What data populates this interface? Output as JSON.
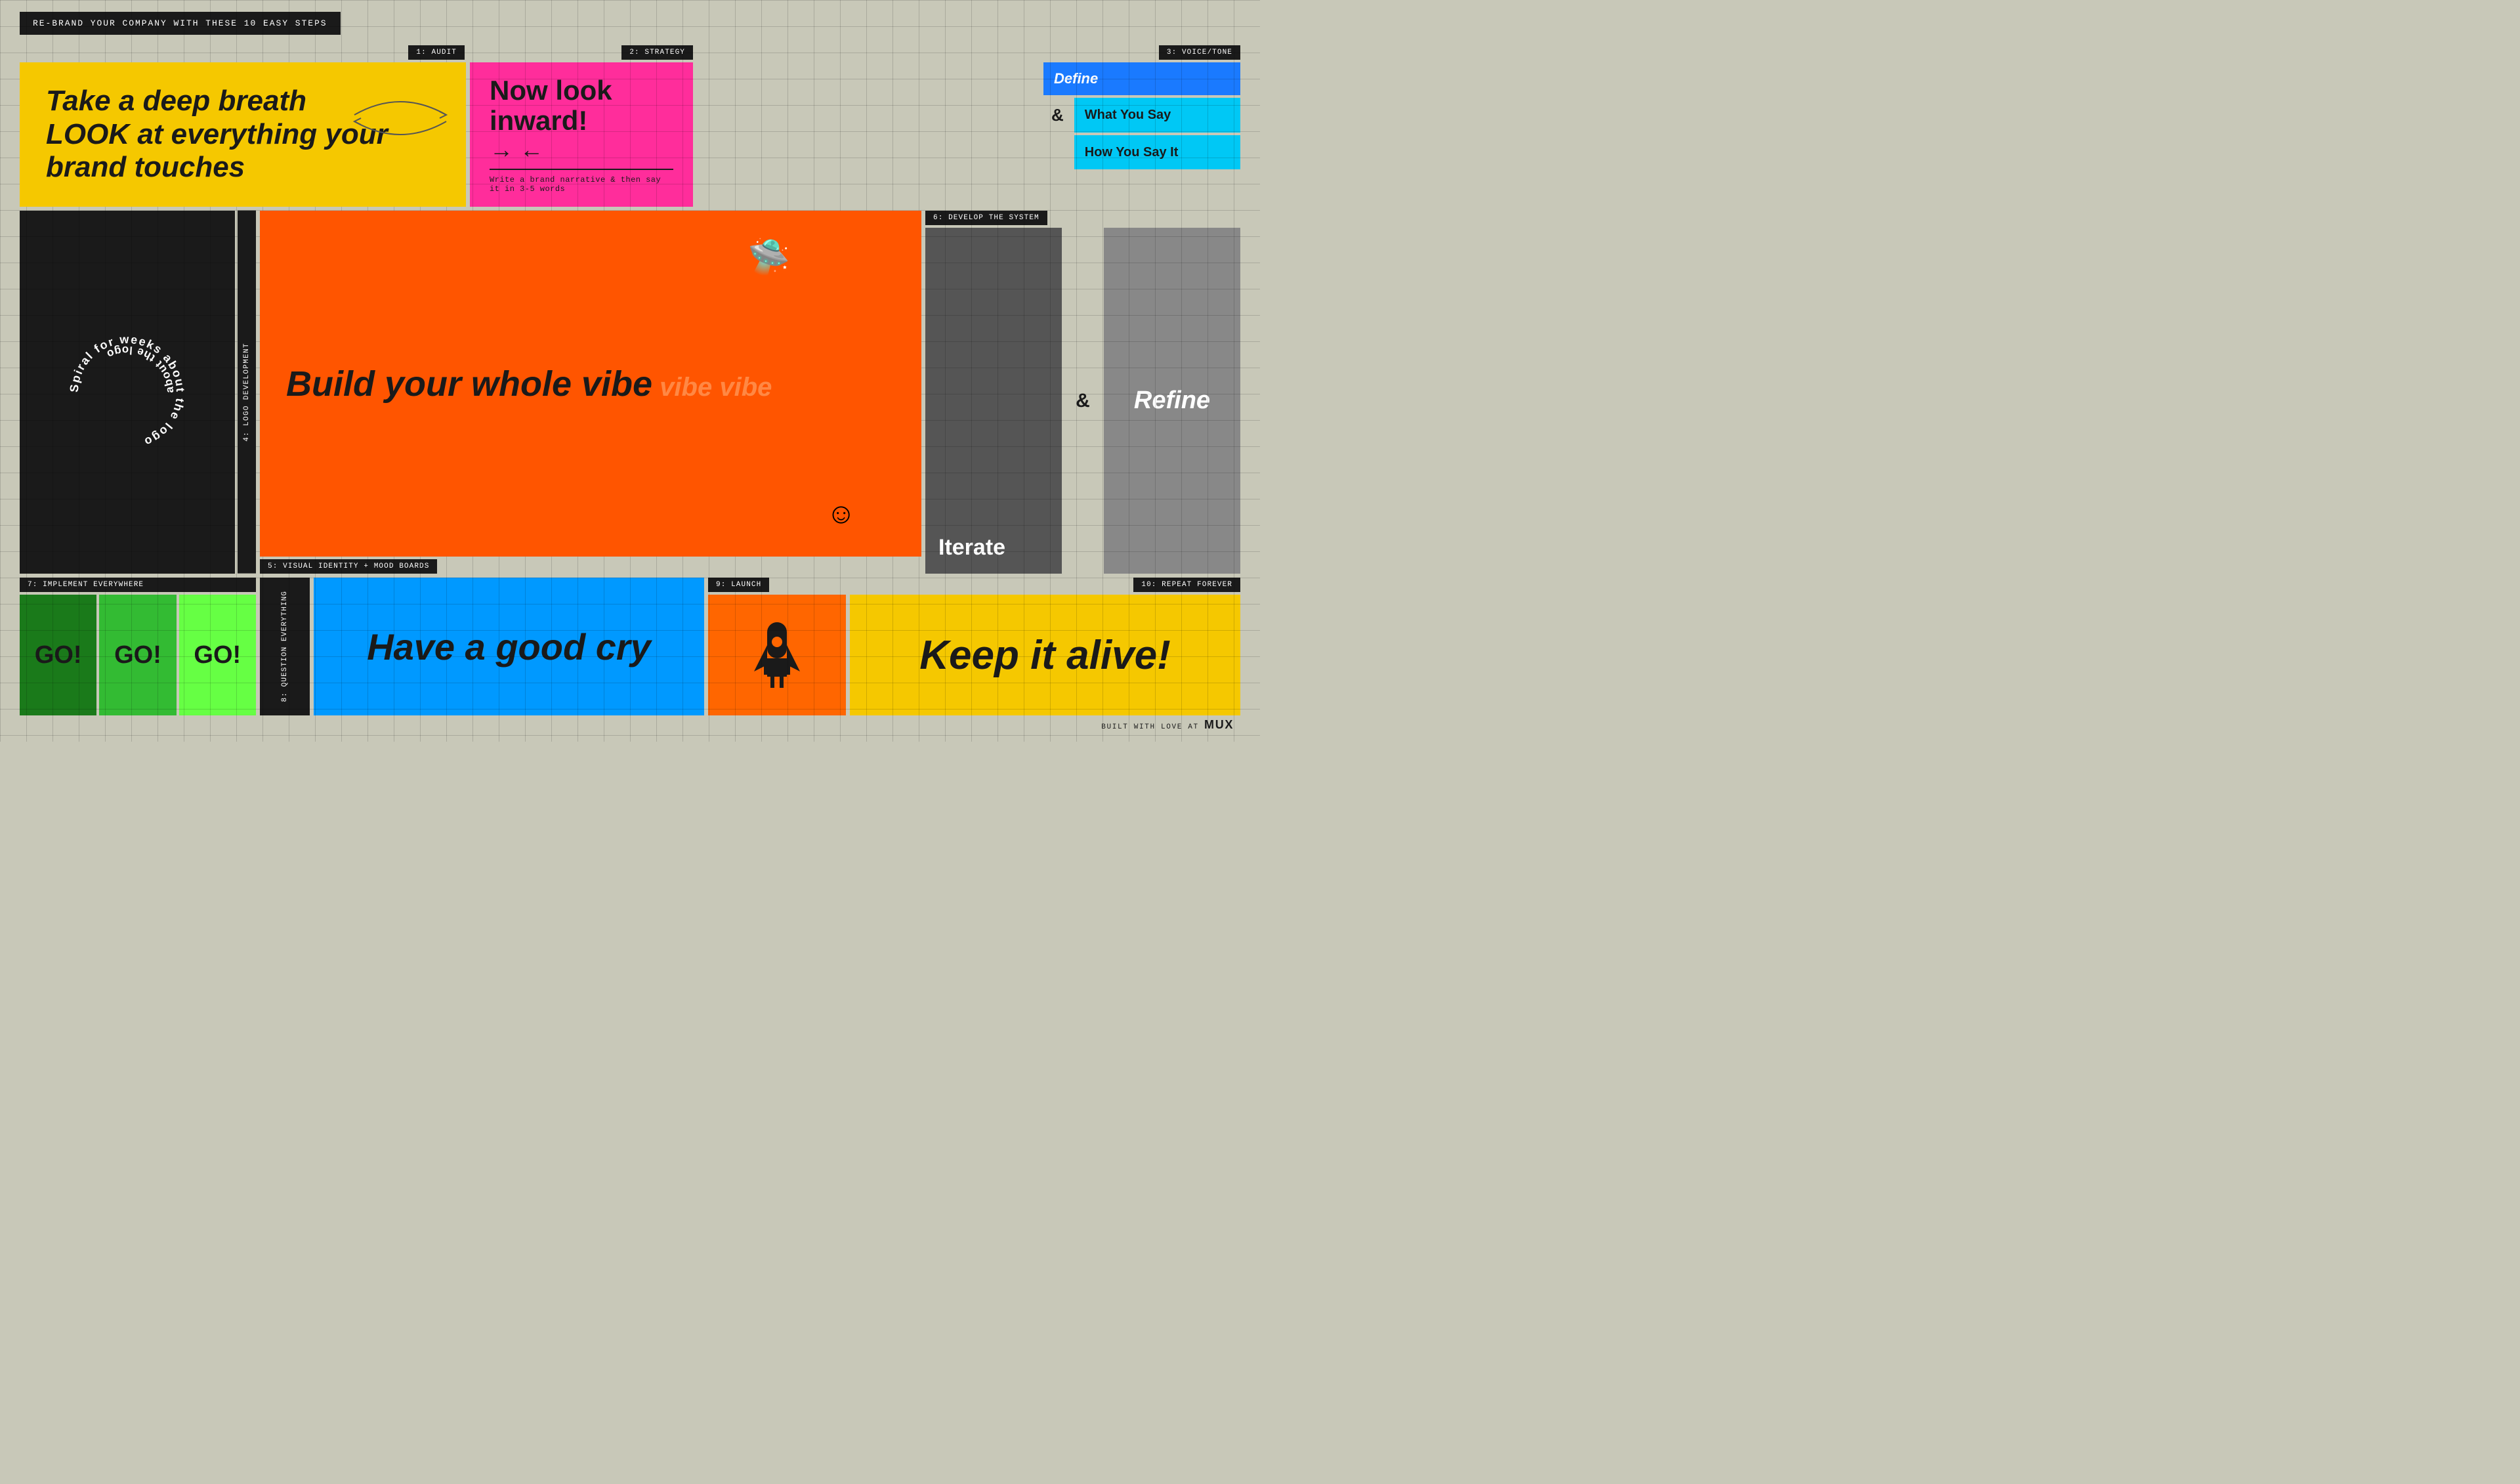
{
  "title": "RE-BRAND YOUR COMPANY WITH THESE 10 EASY STEPS",
  "steps": {
    "audit": {
      "label": "1: AUDIT",
      "text_line1": "Take a deep breath",
      "text_line2": "LOOK at everything your brand touches"
    },
    "strategy": {
      "label": "2: STRATEGY",
      "text": "Now look inward!",
      "arrows": "→ ←",
      "sub": "Write a brand narrative & then say it in 3-5 words"
    },
    "voice_tone": {
      "label": "3: VOICE/TONE",
      "define": "Define",
      "what_you_say": "What You Say",
      "amp": "&",
      "how_you_say": "How You Say It"
    },
    "logo_dev": {
      "label": "4: LOGO DEVELOPMENT",
      "spiral_text": "Spiral for weeks about the logo"
    },
    "visual_identity": {
      "label": "5: VISUAL IDENTITY + MOOD BOARDS",
      "text_main": "Build your whole vibe",
      "text_repeat": " vibe vibe"
    },
    "develop": {
      "label": "6: DEVELOP THE SYSTEM",
      "iterate": "Iterate",
      "amp": "&",
      "refine": "Refine"
    },
    "implement": {
      "label": "7: IMPLEMENT EVERYWHERE",
      "go1": "GO!",
      "go2": "GO!",
      "go3": "GO!"
    },
    "question": {
      "label": "8: QUESTION EVERYTHING"
    },
    "cry": {
      "text": "Have a good cry"
    },
    "launch": {
      "label": "9: LAUNCH"
    },
    "repeat": {
      "label": "10: REPEAT FOREVER",
      "text": "Keep it alive!"
    }
  },
  "footer": {
    "text": "BUILT WITH LOVE AT",
    "brand": "MUX"
  },
  "colors": {
    "yellow": "#f5c800",
    "magenta": "#ff2d9b",
    "blue": "#1a7aff",
    "cyan": "#00c8f5",
    "orange": "#ff5500",
    "bright_blue": "#0099ff",
    "dark": "#1a1a1a",
    "go_dark": "#1a7a1a",
    "go_medium": "#33bb33",
    "go_bright": "#66ff44",
    "bg": "#c8c8b8",
    "gray_dark": "#555555",
    "gray_mid": "#888888",
    "launch_orange": "#ff6600"
  }
}
